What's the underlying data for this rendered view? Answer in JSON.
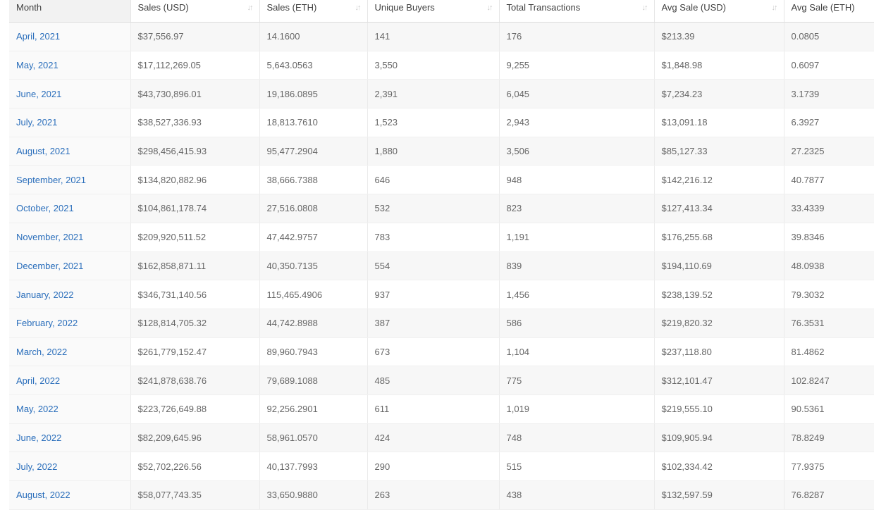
{
  "table": {
    "columns": [
      {
        "label": "Month",
        "sortable": false
      },
      {
        "label": "Sales (USD)",
        "sortable": true
      },
      {
        "label": "Sales (ETH)",
        "sortable": true
      },
      {
        "label": "Unique Buyers",
        "sortable": true
      },
      {
        "label": "Total Transactions",
        "sortable": true
      },
      {
        "label": "Avg Sale (USD)",
        "sortable": true
      },
      {
        "label": "Avg Sale (ETH)",
        "sortable": false
      }
    ],
    "sort_icon": "sort-arrows-icon",
    "rows": [
      [
        "April, 2021",
        "$37,556.97",
        "14.1600",
        "141",
        "176",
        "$213.39",
        "0.0805"
      ],
      [
        "May, 2021",
        "$17,112,269.05",
        "5,643.0563",
        "3,550",
        "9,255",
        "$1,848.98",
        "0.6097"
      ],
      [
        "June, 2021",
        "$43,730,896.01",
        "19,186.0895",
        "2,391",
        "6,045",
        "$7,234.23",
        "3.1739"
      ],
      [
        "July, 2021",
        "$38,527,336.93",
        "18,813.7610",
        "1,523",
        "2,943",
        "$13,091.18",
        "6.3927"
      ],
      [
        "August, 2021",
        "$298,456,415.93",
        "95,477.2904",
        "1,880",
        "3,506",
        "$85,127.33",
        "27.2325"
      ],
      [
        "September, 2021",
        "$134,820,882.96",
        "38,666.7388",
        "646",
        "948",
        "$142,216.12",
        "40.7877"
      ],
      [
        "October, 2021",
        "$104,861,178.74",
        "27,516.0808",
        "532",
        "823",
        "$127,413.34",
        "33.4339"
      ],
      [
        "November, 2021",
        "$209,920,511.52",
        "47,442.9757",
        "783",
        "1,191",
        "$176,255.68",
        "39.8346"
      ],
      [
        "December, 2021",
        "$162,858,871.11",
        "40,350.7135",
        "554",
        "839",
        "$194,110.69",
        "48.0938"
      ],
      [
        "January, 2022",
        "$346,731,140.56",
        "115,465.4906",
        "937",
        "1,456",
        "$238,139.52",
        "79.3032"
      ],
      [
        "February, 2022",
        "$128,814,705.32",
        "44,742.8988",
        "387",
        "586",
        "$219,820.32",
        "76.3531"
      ],
      [
        "March, 2022",
        "$261,779,152.47",
        "89,960.7943",
        "673",
        "1,104",
        "$237,118.80",
        "81.4862"
      ],
      [
        "April, 2022",
        "$241,878,638.76",
        "79,689.1088",
        "485",
        "775",
        "$312,101.47",
        "102.8247"
      ],
      [
        "May, 2022",
        "$223,726,649.88",
        "92,256.2901",
        "611",
        "1,019",
        "$219,555.10",
        "90.5361"
      ],
      [
        "June, 2022",
        "$82,209,645.96",
        "58,961.0570",
        "424",
        "748",
        "$109,905.94",
        "78.8249"
      ],
      [
        "July, 2022",
        "$52,702,226.56",
        "40,137.7993",
        "290",
        "515",
        "$102,334.42",
        "77.9375"
      ],
      [
        "August, 2022",
        "$58,077,743.35",
        "33,650.9880",
        "263",
        "438",
        "$132,597.59",
        "76.8287"
      ]
    ]
  }
}
